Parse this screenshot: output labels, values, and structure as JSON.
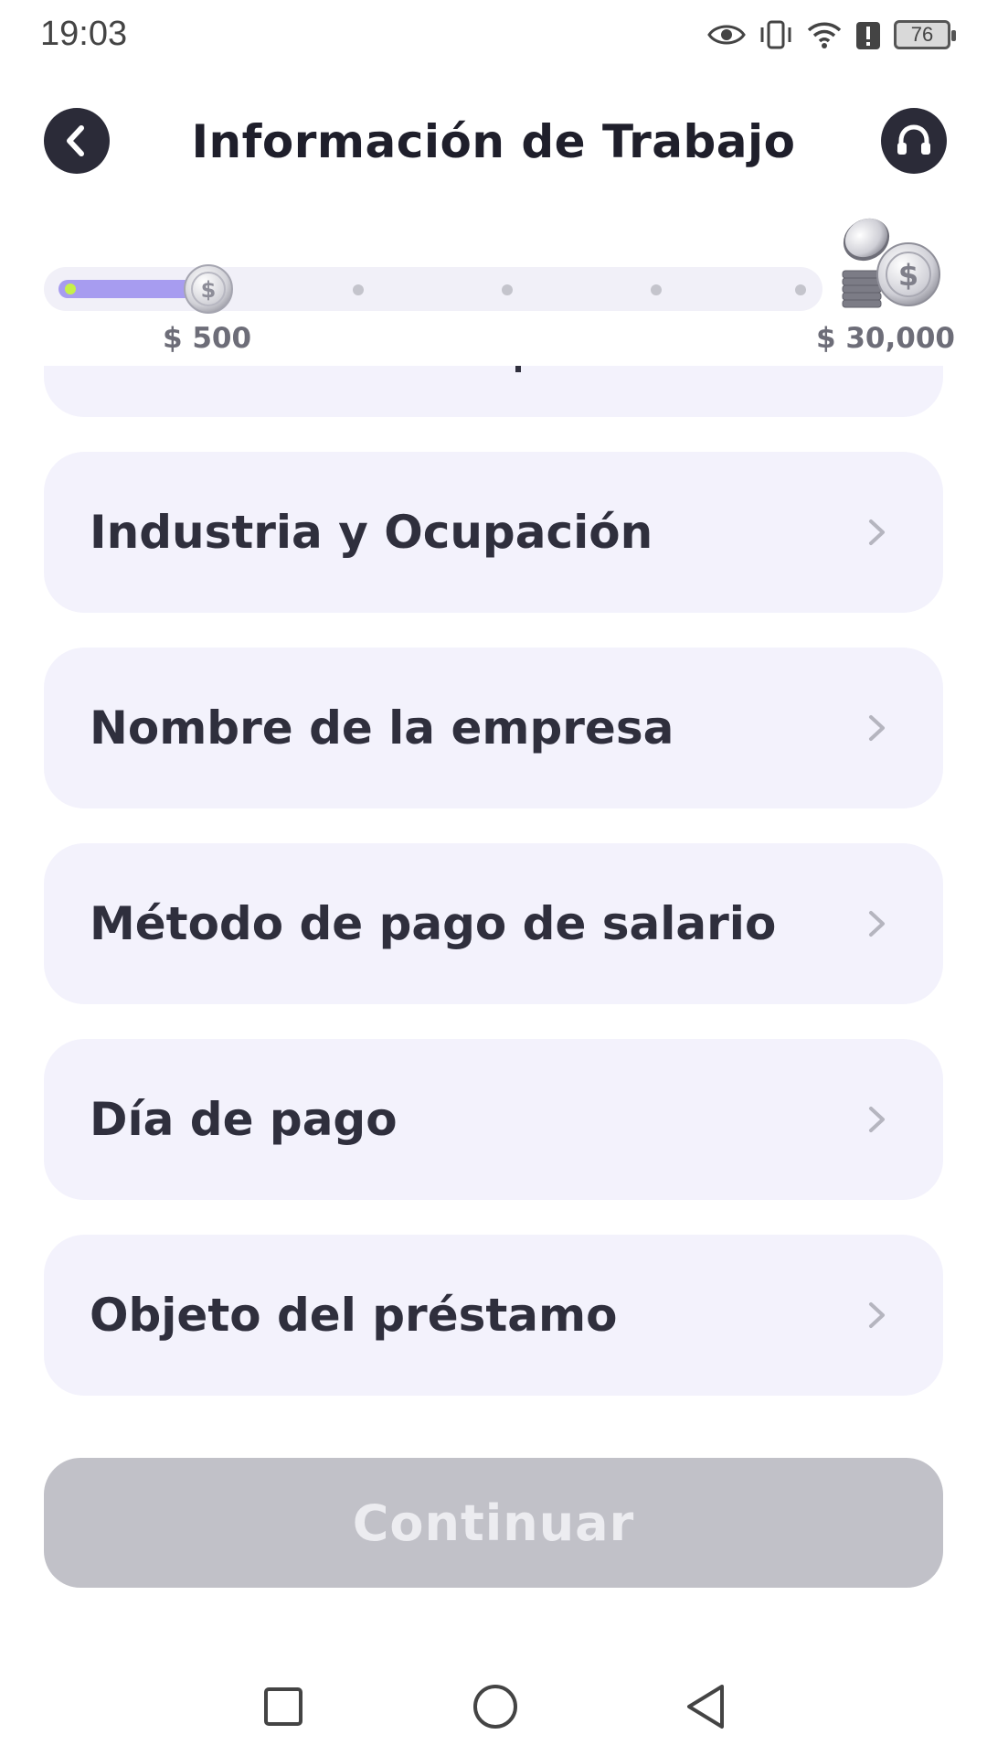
{
  "status_bar": {
    "time": "19:03",
    "battery": "76",
    "icons": [
      "eye-icon",
      "vibrate-icon",
      "wifi-icon",
      "alert-icon",
      "battery-icon"
    ]
  },
  "header": {
    "title": "Información de Trabajo",
    "back_icon": "chevron-left-icon",
    "support_icon": "headset-icon"
  },
  "progress": {
    "min_label": "$ 500",
    "max_label": "$ 30,000",
    "current_step": 1,
    "total_steps": 6,
    "colors": {
      "fill": "#a79cf0",
      "track": "#f1f0f8",
      "start_dot": "#c6f04a"
    }
  },
  "list": {
    "items": [
      {
        "label": "Industria y Ocupación"
      },
      {
        "label": "Nombre de la empresa"
      },
      {
        "label": "Método de pago de salario"
      },
      {
        "label": "Día de pago"
      },
      {
        "label": "Objeto del préstamo"
      }
    ]
  },
  "continue_button": {
    "label": "Continuar",
    "enabled": false
  },
  "nav_bar": {
    "icons": [
      "recent-apps-icon",
      "home-icon",
      "back-triangle-icon"
    ]
  }
}
